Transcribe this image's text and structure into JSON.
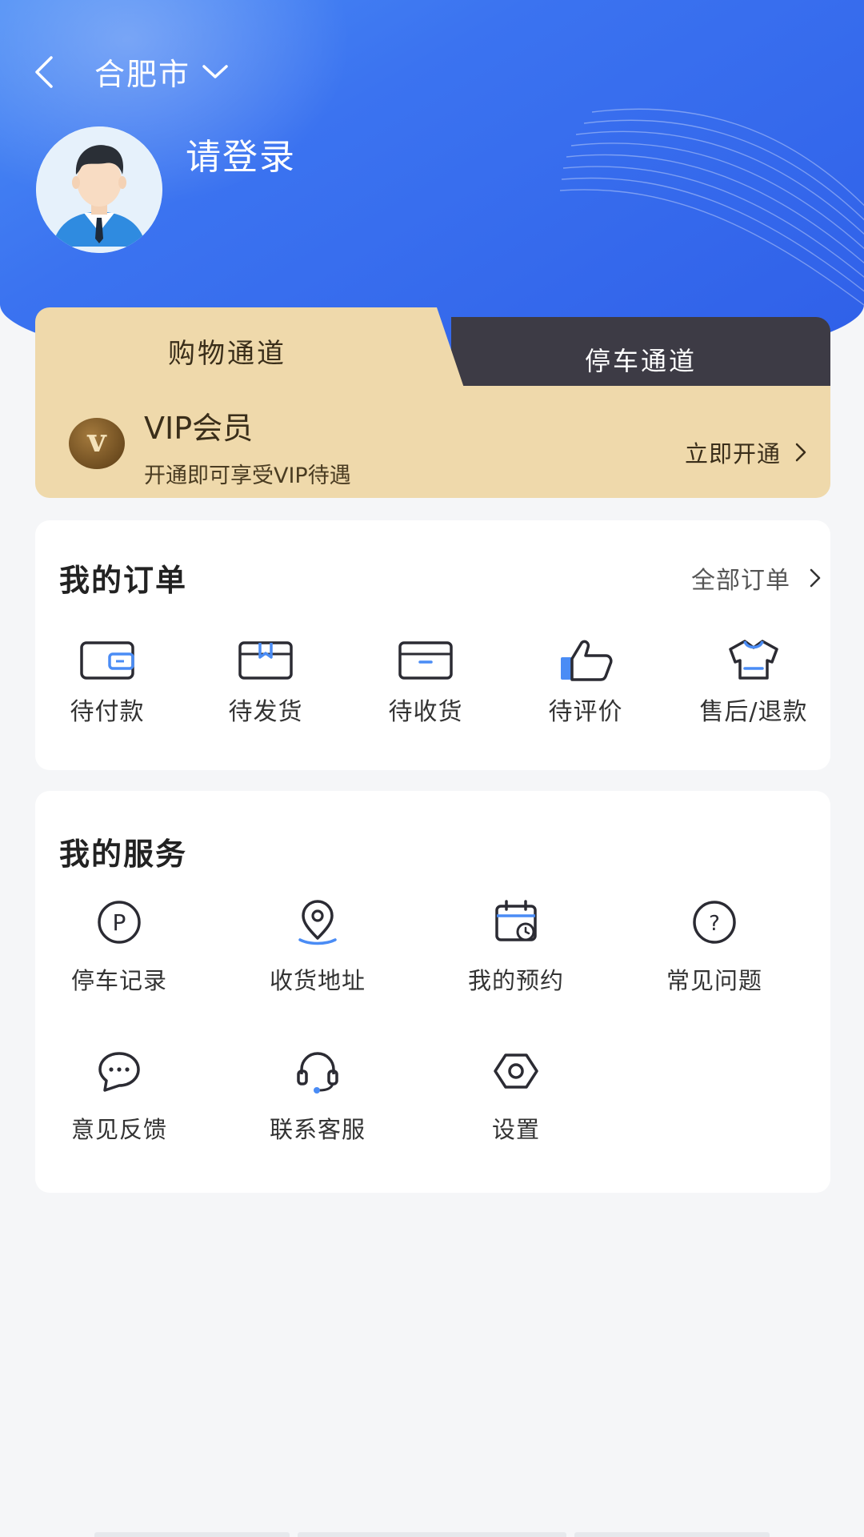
{
  "header": {
    "city": "合肥市",
    "login_prompt": "请登录"
  },
  "channels": {
    "tabs": [
      {
        "label": "购物通道",
        "active": true
      },
      {
        "label": "停车通道",
        "active": false
      }
    ],
    "vip": {
      "badge_letter": "v",
      "title": "VIP会员",
      "subtitle": "开通即可享受VIP待遇",
      "action": "立即开通"
    }
  },
  "orders": {
    "title": "我的订单",
    "all_label": "全部订单",
    "items": [
      {
        "label": "待付款",
        "icon": "wallet-icon"
      },
      {
        "label": "待发货",
        "icon": "package-icon"
      },
      {
        "label": "待收货",
        "icon": "box-icon"
      },
      {
        "label": "待评价",
        "icon": "thumbs-up-icon"
      },
      {
        "label": "售后/退款",
        "icon": "return-shirt-icon"
      }
    ]
  },
  "services": {
    "title": "我的服务",
    "items": [
      {
        "label": "停车记录",
        "icon": "parking-icon"
      },
      {
        "label": "收货地址",
        "icon": "location-pin-icon"
      },
      {
        "label": "我的预约",
        "icon": "calendar-clock-icon"
      },
      {
        "label": "常见问题",
        "icon": "question-icon"
      },
      {
        "label": "意见反馈",
        "icon": "chat-bubble-icon"
      },
      {
        "label": "联系客服",
        "icon": "headset-icon"
      },
      {
        "label": "设置",
        "icon": "settings-hexagon-icon"
      }
    ]
  },
  "colors": {
    "hero_blue": "#3b73f0",
    "vip_gold": "#efd9ab",
    "tab_dark": "#3d3b45",
    "icon_stroke": "#2b2b33",
    "icon_accent": "#4a8cf5"
  }
}
